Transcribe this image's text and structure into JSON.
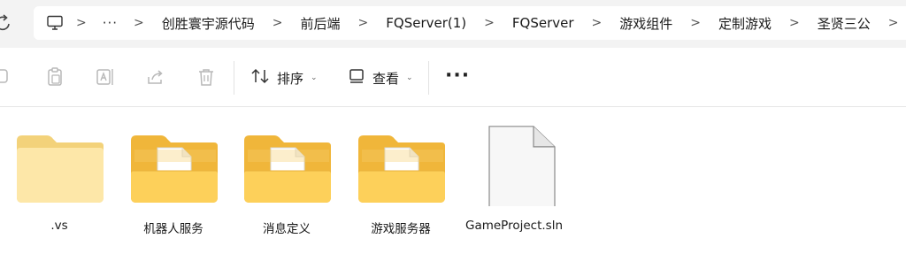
{
  "breadcrumb": {
    "more": "···",
    "items": [
      "创胜寰宇源代码",
      "前后端",
      "FQServer(1)",
      "FQServer",
      "游戏组件",
      "定制游戏",
      "圣贤三公"
    ]
  },
  "toolbar": {
    "sort_label": "排序",
    "view_label": "查看",
    "more_label": "···"
  },
  "files": [
    {
      "name": ".vs",
      "type": "folder-empty",
      "icon": "folder-icon"
    },
    {
      "name": "机器人服务",
      "type": "folder-docs",
      "icon": "folder-icon"
    },
    {
      "name": "消息定义",
      "type": "folder-docs",
      "icon": "folder-icon"
    },
    {
      "name": "游戏服务器",
      "type": "folder-docs",
      "icon": "folder-icon"
    },
    {
      "name": "GameProject.sln",
      "type": "file",
      "icon": "file-icon"
    }
  ],
  "colors": {
    "folder_back": "#f4b93a",
    "folder_front": "#fcd25a",
    "folder_empty": "#fde7a8",
    "toolbar_icon": "#b8b8b8"
  }
}
